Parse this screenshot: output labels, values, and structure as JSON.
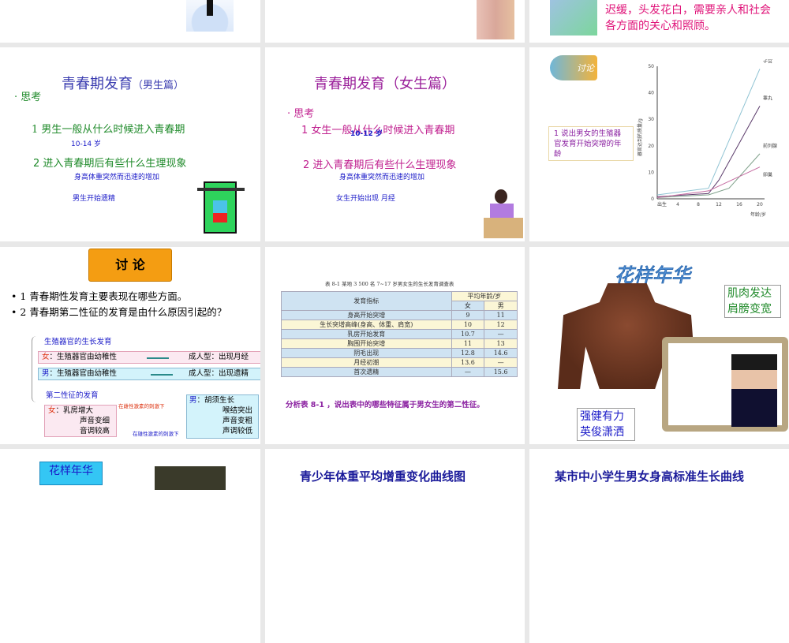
{
  "slides": {
    "s3": {
      "line1": "迟缓，头发花白，需要亲人和社会",
      "line2": "各方面的关心和照顾。"
    },
    "s4": {
      "title": "青春期发育",
      "title_small": "（男生篇）",
      "bullet": "思考",
      "q1": "1   男生一般从什么时候进入青春期",
      "a1": "10-14 岁",
      "q2": "2  进入青春期后有些什么生理现象",
      "a2": "身高体重突然而迅速的增加",
      "a3": "男生开始遗精"
    },
    "s5": {
      "title": "青春期发育（女生篇）",
      "bullet": "思考",
      "q1": "1   女生一般从什么时候进入青春期",
      "a1": "10-12 岁",
      "q2": "2  进入青春期后有些什么生理现象",
      "a2": "身高体重突然而迅速的增加",
      "a3": "女生开始出现  月经"
    },
    "s6": {
      "badge": "讨论",
      "question": "1  说出男女的生殖器官发育开始突增的年龄"
    },
    "s7": {
      "banner": "讨 论",
      "b1": "1   青春期性发育主要表现在哪些方面。",
      "b2": "2    青春期第二性征的发育是由什么原因引起的？",
      "h1": "生殖器官的生长发育",
      "f_label": "女",
      "f_text": "：生殖器官由幼稚性",
      "f_result": "成人型：出现月经",
      "m_label": "男",
      "m_text": "：生殖器官由幼稚性",
      "m_result": "成人型：出现遗精",
      "h2": "第二性征的发育",
      "f2_label": "女",
      "f2_lines": [
        "：乳房增大",
        "声音变细",
        "音调较高"
      ],
      "f_hormone": "在雌性激素的刺激下",
      "m2_label": "男",
      "m2_lines": [
        "：胡须生长",
        "喉结突出",
        "声音变粗",
        "声调较低"
      ],
      "m_hormone": "在雄性激素的刺激下"
    },
    "s8": {
      "caption": "表  8-1    某地 3 500 名 7~17 岁男女生的生长发育调查表",
      "col_indicator": "发育指标",
      "col_avg": "平均年龄/岁",
      "col_f": "女",
      "col_m": "男",
      "rows": [
        [
          "身高开始突增",
          "9",
          "11"
        ],
        [
          "生长突增高峰(身高、体重、肩宽)",
          "10",
          "12"
        ],
        [
          "乳房开始发育",
          "10.7",
          "—"
        ],
        [
          "胸围开始突增",
          "11",
          "13"
        ],
        [
          "阴毛出现",
          "12.8",
          "14.6"
        ],
        [
          "月经初潮",
          "13.6",
          "—"
        ],
        [
          "首次遗精",
          "—",
          "15.6"
        ]
      ],
      "prompt": "分析表 8-1  ，说出表中的哪些特征属于男女生的第二性征。"
    },
    "s9": {
      "title": "花样年华",
      "box1": [
        "肌肉发达",
        "肩膀变宽"
      ],
      "box2": [
        "强健有力",
        "英俊潇洒"
      ]
    },
    "s10": {
      "title": "花样年华"
    },
    "s11": {
      "title": "青少年体重平均增重变化曲线图"
    },
    "s12": {
      "title": "某市中小学生男女身高标准生长曲线"
    }
  },
  "chart_data": {
    "type": "line",
    "title": "",
    "xlabel": "年龄/岁",
    "ylabel": "器官达到的质量/g",
    "xlim": [
      0,
      20
    ],
    "ylim": [
      0,
      50
    ],
    "xticks": [
      {
        "v": 0,
        "l": "出生"
      },
      {
        "v": 4,
        "l": "4"
      },
      {
        "v": 8,
        "l": "8"
      },
      {
        "v": 12,
        "l": "12"
      },
      {
        "v": 16,
        "l": "16"
      },
      {
        "v": 20,
        "l": "20"
      }
    ],
    "yticks": [
      0,
      10,
      20,
      30,
      40,
      50
    ],
    "series": [
      {
        "name": "子宫",
        "color": "#8fc3d3",
        "points": [
          [
            0,
            1.5
          ],
          [
            10,
            4
          ],
          [
            20,
            49
          ]
        ]
      },
      {
        "name": "睾丸",
        "color": "#5a3a6a",
        "points": [
          [
            0,
            0.8
          ],
          [
            10,
            2
          ],
          [
            12,
            7
          ],
          [
            20,
            35
          ]
        ]
      },
      {
        "name": "前列腺",
        "color": "#7fa08a",
        "points": [
          [
            0,
            0.5
          ],
          [
            10,
            1.5
          ],
          [
            14,
            4
          ],
          [
            20,
            17
          ]
        ]
      },
      {
        "name": "卵巢",
        "color": "#c46aa0",
        "points": [
          [
            0,
            0.5
          ],
          [
            10,
            3
          ],
          [
            20,
            12
          ]
        ]
      }
    ]
  }
}
